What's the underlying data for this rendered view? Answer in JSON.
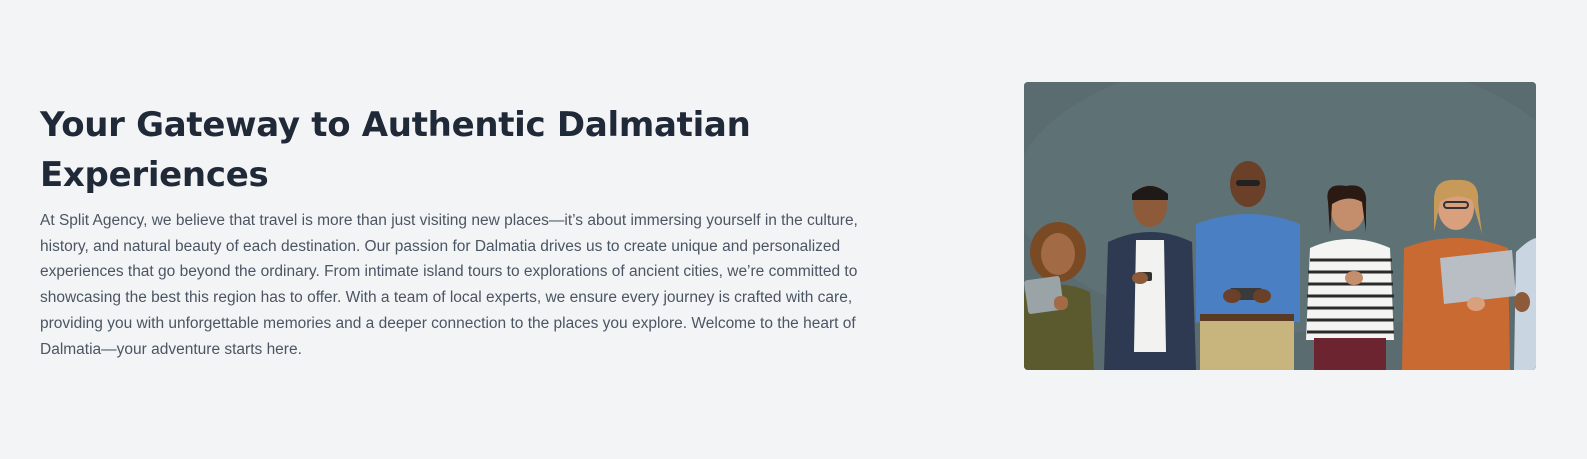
{
  "about": {
    "title": "Your Gateway to Authentic Dalmatian Experiences",
    "body": "At Split Agency, we believe that travel is more than just visiting new places—it’s about immersing yourself in the culture, history, and natural beauty of each destination. Our passion for Dalmatia drives us to create unique and personalized experiences that go beyond the ordinary. From intimate island tours to explorations of ancient cities, we’re committed to showcasing the best this region has to offer. With a team of local experts, we ensure every journey is crafted with care, providing you with unforgettable memories and a deeper connection to the places you explore. Welcome to the heart of Dalmatia—your adventure starts here."
  },
  "image": {
    "alt": "Team members smiling and holding tablets and phones",
    "colors": {
      "wall": "#5a6c70",
      "shirt_blue": "#4a7fc4",
      "dress_orange": "#c86a32",
      "pants_khaki": "#c8b57e"
    }
  }
}
